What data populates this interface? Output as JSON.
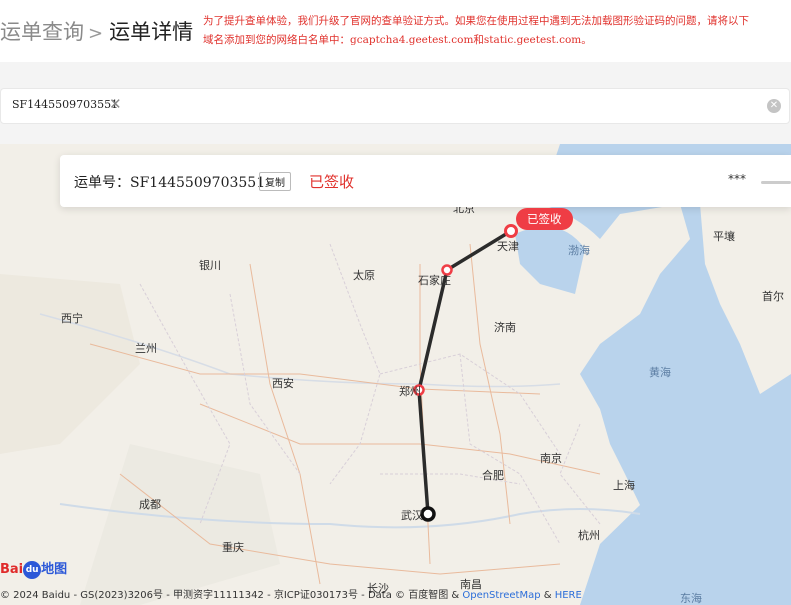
{
  "breadcrumb": {
    "prev": "运单查询",
    "separator": ">",
    "current": "运单详情"
  },
  "notice": {
    "line1": "为了提升查单体验，我们升级了官网的查单验证方式。如果您在使用过程中遇到无法加载图形验证码的问题，请将以下",
    "line2": "域名添加到您的网络白名单中：gcaptcha4.geetest.com和static.geetest.com。"
  },
  "search": {
    "tag": "SF1445509703551",
    "tag_close": "✕",
    "clear": "✕"
  },
  "waybill": {
    "label": "运单号：",
    "number": "SF1445509703551",
    "copy_label": "复制",
    "status": "已签收",
    "masked": "***"
  },
  "pin_label": "已签收",
  "map": {
    "route_color": "#2b2b2b",
    "pin_color": "#ef3d45",
    "cities": [
      {
        "name": "天津"
      },
      {
        "name": "石家庄"
      },
      {
        "name": "太原"
      },
      {
        "name": "银川"
      },
      {
        "name": "西宁"
      },
      {
        "name": "兰州"
      },
      {
        "name": "西安"
      },
      {
        "name": "郑州"
      },
      {
        "name": "济南"
      },
      {
        "name": "合肥"
      },
      {
        "name": "南京"
      },
      {
        "name": "上海"
      },
      {
        "name": "杭州"
      },
      {
        "name": "武汉"
      },
      {
        "name": "成都"
      },
      {
        "name": "重庆"
      },
      {
        "name": "长沙"
      },
      {
        "name": "南昌"
      },
      {
        "name": "平壤"
      },
      {
        "name": "首尔"
      },
      {
        "name": "北京"
      }
    ],
    "seas": [
      "渤海",
      "黄海",
      "东海"
    ]
  },
  "footer": {
    "copyright": "© 2024 Baidu - GS(2023)3206号 - 甲测资字11111342 - 京ICP证030173号 - Data © 百度智图 & ",
    "osm": "OpenStreetMap",
    "amp": " & ",
    "here": "HERE",
    "logo_bai": "Bai",
    "logo_du": "du",
    "logo_map": "地图"
  }
}
